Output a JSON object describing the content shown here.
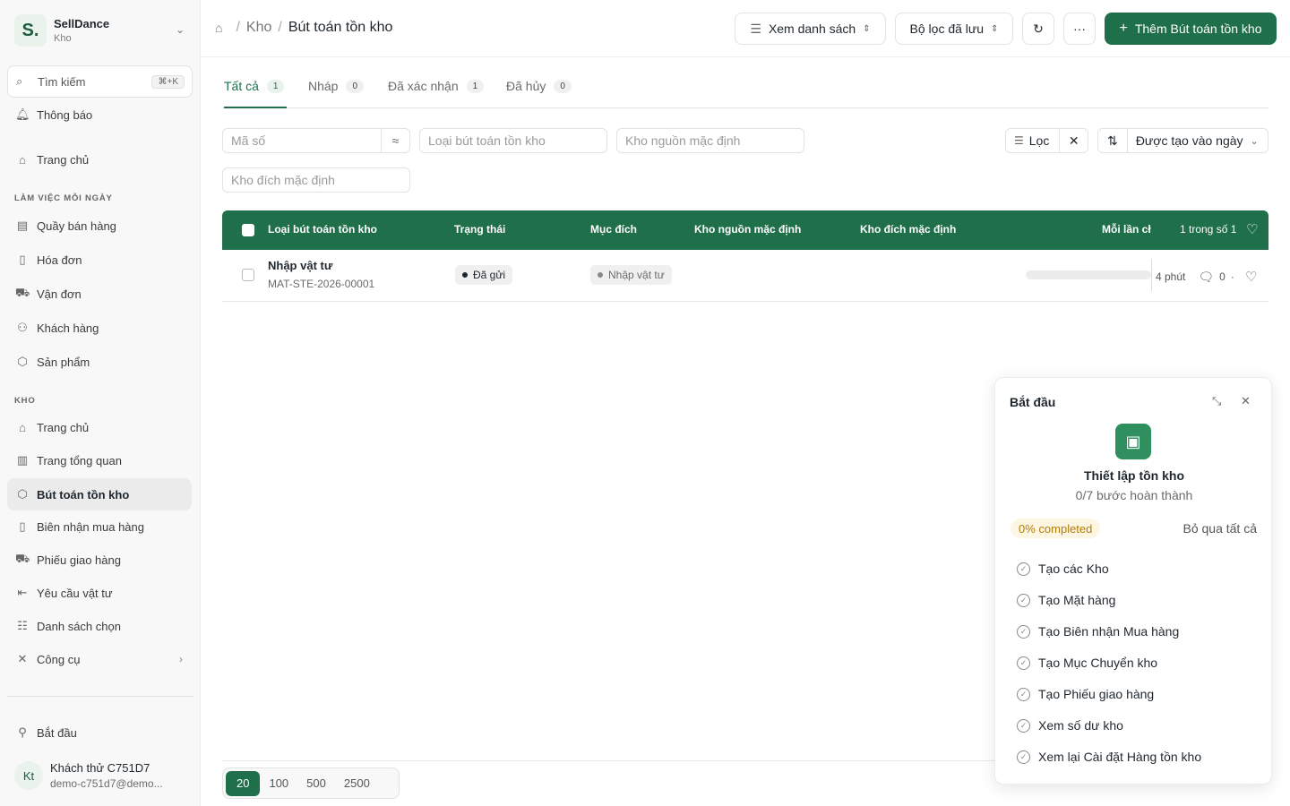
{
  "brand": {
    "logo": "S.",
    "name": "SellDance",
    "sub": "Kho"
  },
  "search": {
    "label": "Tìm kiếm",
    "shortcut": "⌘+K"
  },
  "sidebar": {
    "notifications": "Thông báo",
    "home": "Trang chủ",
    "section_daily": "LÀM VIỆC MỖI NGÀY",
    "daily_items": [
      {
        "label": "Quầy bán hàng",
        "icon": "store-icon"
      },
      {
        "label": "Hóa đơn",
        "icon": "invoice-icon"
      },
      {
        "label": "Vận đơn",
        "icon": "truck-icon"
      },
      {
        "label": "Khách hàng",
        "icon": "users-icon"
      },
      {
        "label": "Sản phẩm",
        "icon": "box-icon"
      }
    ],
    "section_stock": "KHO",
    "stock_items": [
      {
        "label": "Trang chủ",
        "icon": "home-icon"
      },
      {
        "label": "Trang tổng quan",
        "icon": "bar-chart-icon"
      },
      {
        "label": "Bút toán tồn kho",
        "icon": "box-icon"
      },
      {
        "label": "Biên nhận mua hàng",
        "icon": "receipt-icon"
      },
      {
        "label": "Phiếu giao hàng",
        "icon": "truck-icon"
      },
      {
        "label": "Yêu cầu vật tư",
        "icon": "arrow-left-bar-icon"
      },
      {
        "label": "Danh sách chọn",
        "icon": "list-icon"
      },
      {
        "label": "Công cụ",
        "icon": "tools-icon"
      }
    ],
    "getting_started": "Bắt đầu",
    "user": {
      "initials": "Kt",
      "name": "Khách thử C751D7",
      "email": "demo-c751d7@demo..."
    }
  },
  "header": {
    "breadcrumb": [
      "Kho",
      "Bút toán tồn kho"
    ],
    "view_list": "Xem danh sách",
    "saved_filters": "Bộ lọc đã lưu",
    "more": "···",
    "add_button": "Thêm Bút toán tồn kho"
  },
  "tabs": [
    {
      "label": "Tất cả",
      "count": "1"
    },
    {
      "label": "Nháp",
      "count": "0"
    },
    {
      "label": "Đã xác nhận",
      "count": "1"
    },
    {
      "label": "Đã hủy",
      "count": "0"
    }
  ],
  "filters": {
    "code_placeholder": "Mã số",
    "type_placeholder": "Loại bút toán tồn kho",
    "source_placeholder": "Kho nguồn mặc định",
    "target_placeholder": "Kho đích mặc định",
    "filter_label": "Lọc",
    "sort_label": "Được tạo vào ngày"
  },
  "table": {
    "columns": [
      "Loại bút toán tồn kho",
      "Trạng thái",
      "Mục đích",
      "Kho nguồn mặc định",
      "Kho đích mặc định",
      "Mỗi lần cł",
      "1 trong số 1"
    ],
    "rows": [
      {
        "title": "Nhập vật tư",
        "code": "MAT-STE-2026-00001",
        "status": "Đã gửi",
        "purpose": "Nhập vật tư",
        "progress": 0,
        "time": "4 phút",
        "comments": "0",
        "dot": "·"
      }
    ]
  },
  "pagination": [
    "20",
    "100",
    "500",
    "2500"
  ],
  "onboarding": {
    "title": "Bắt đầu",
    "heading": "Thiết lập tồn kho",
    "subheading": "0/7 bước hoàn thành",
    "progress_badge": "0% completed",
    "skip": "Bỏ qua tất cả",
    "steps": [
      "Tạo các Kho",
      "Tạo Mặt hàng",
      "Tạo Biên nhận Mua hàng",
      "Tạo Mục Chuyển kho",
      "Tạo Phiếu giao hàng",
      "Xem số dư kho",
      "Xem lại Cài đặt Hàng tồn kho"
    ]
  },
  "colors": {
    "brand": "#1f6f4a",
    "badge": "#b07d0a"
  }
}
